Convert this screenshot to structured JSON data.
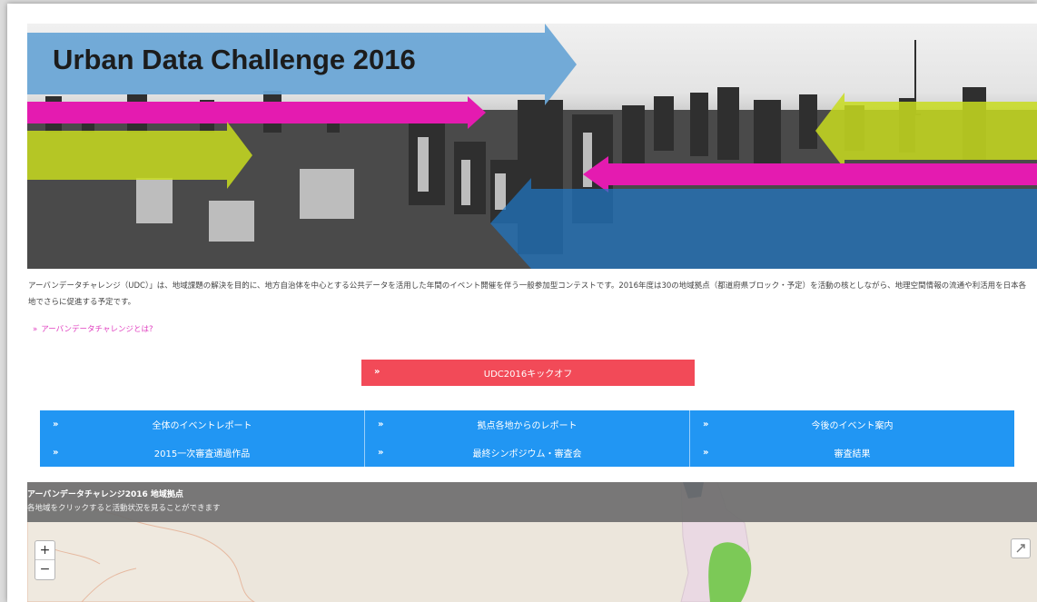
{
  "hero": {
    "title": "Urban Data Challenge 2016",
    "colors": {
      "blue_arrow": "#6ba6d6",
      "magenta_arrow": "#e41bb0",
      "lime_arrow": "#c8dc1e",
      "blue_overlay": "#1e78c8"
    }
  },
  "intro": {
    "text": "アーバンデータチャレンジ（UDC）」は、地域課題の解決を目的に、地方自治体を中心とする公共データを活用した年間のイベント開催を伴う一般参加型コンテストです。2016年度は30の地域拠点（都道府県ブロック・予定）を活動の核としながら、地理空間情報の流通や利活用を日本各地でさらに促進する予定です。",
    "about_link": "アーバンデータチャレンジとは?",
    "link_color": "#e040c0"
  },
  "kickoff": {
    "label": "UDC2016キックオフ",
    "color": "#f24a58"
  },
  "nav": {
    "color": "#2196f3",
    "items": [
      {
        "label": "全体のイベントレポート"
      },
      {
        "label": "拠点各地からのレポート"
      },
      {
        "label": "今後のイベント案内"
      },
      {
        "label": "2015一次審査通過作品"
      },
      {
        "label": "最終シンポジウム・審査会"
      },
      {
        "label": "審査結果"
      }
    ]
  },
  "map": {
    "title": "アーバンデータチャレンジ2016 地域拠点",
    "subtitle": "各地域をクリックすると活動状況を見ることができます",
    "zoom_in": "+",
    "zoom_out": "−",
    "highlight_color": "#7cc957"
  },
  "icons": {
    "chevron": "»",
    "fullscreen": "fullscreen-icon"
  }
}
